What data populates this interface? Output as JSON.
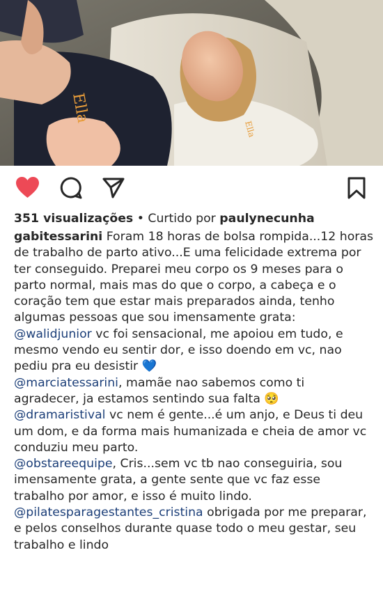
{
  "post": {
    "image_logo_text": "Ella",
    "views": "351 visualizações",
    "separator": " • ",
    "liked_by_prefix": "Curtido por ",
    "liked_by_user": "paulynecunha"
  },
  "icons": {
    "like": "heart-icon",
    "comment": "comment-icon",
    "share": "send-icon",
    "save": "bookmark-icon",
    "like_color": "#ed4956"
  },
  "caption": {
    "username": "gabitessarini",
    "intro": " Foram 18 horas de bolsa rompida...12 horas de trabalho de parto ativo...E uma felicidade extrema por ter conseguido. Preparei meu corpo os 9 meses para o parto normal, mais mas do que o corpo, a cabeça e o coração tem que estar mais preparados ainda, tenho algumas pessoas que sou imensamente grata:",
    "entries": [
      {
        "mention": "@walidjunior",
        "text": " vc foi sensacional, me apoiou em tudo, e mesmo vendo eu sentir dor, e isso doendo em vc, nao pediu pra eu desistir 💙"
      },
      {
        "mention": "@marciatessarini",
        "text": ", mamãe nao sabemos como ti agradecer, ja estamos sentindo sua falta 🥺"
      },
      {
        "mention": "@dramaristival",
        "text": " vc nem é gente...é um anjo, e Deus ti deu um dom, e da forma mais humanizada e cheia de amor vc conduziu meu parto."
      },
      {
        "mention": "@obstareequipe",
        "text": ", Cris...sem vc tb nao conseguiria, sou imensamente grata, a gente sente que vc faz esse trabalho por amor, e isso é muito lindo."
      },
      {
        "mention": "@pilatesparagestantes_cristina",
        "text": " obrigada por me preparar, e pelos conselhos durante quase todo o meu gestar, seu trabalho e lindo"
      }
    ]
  }
}
